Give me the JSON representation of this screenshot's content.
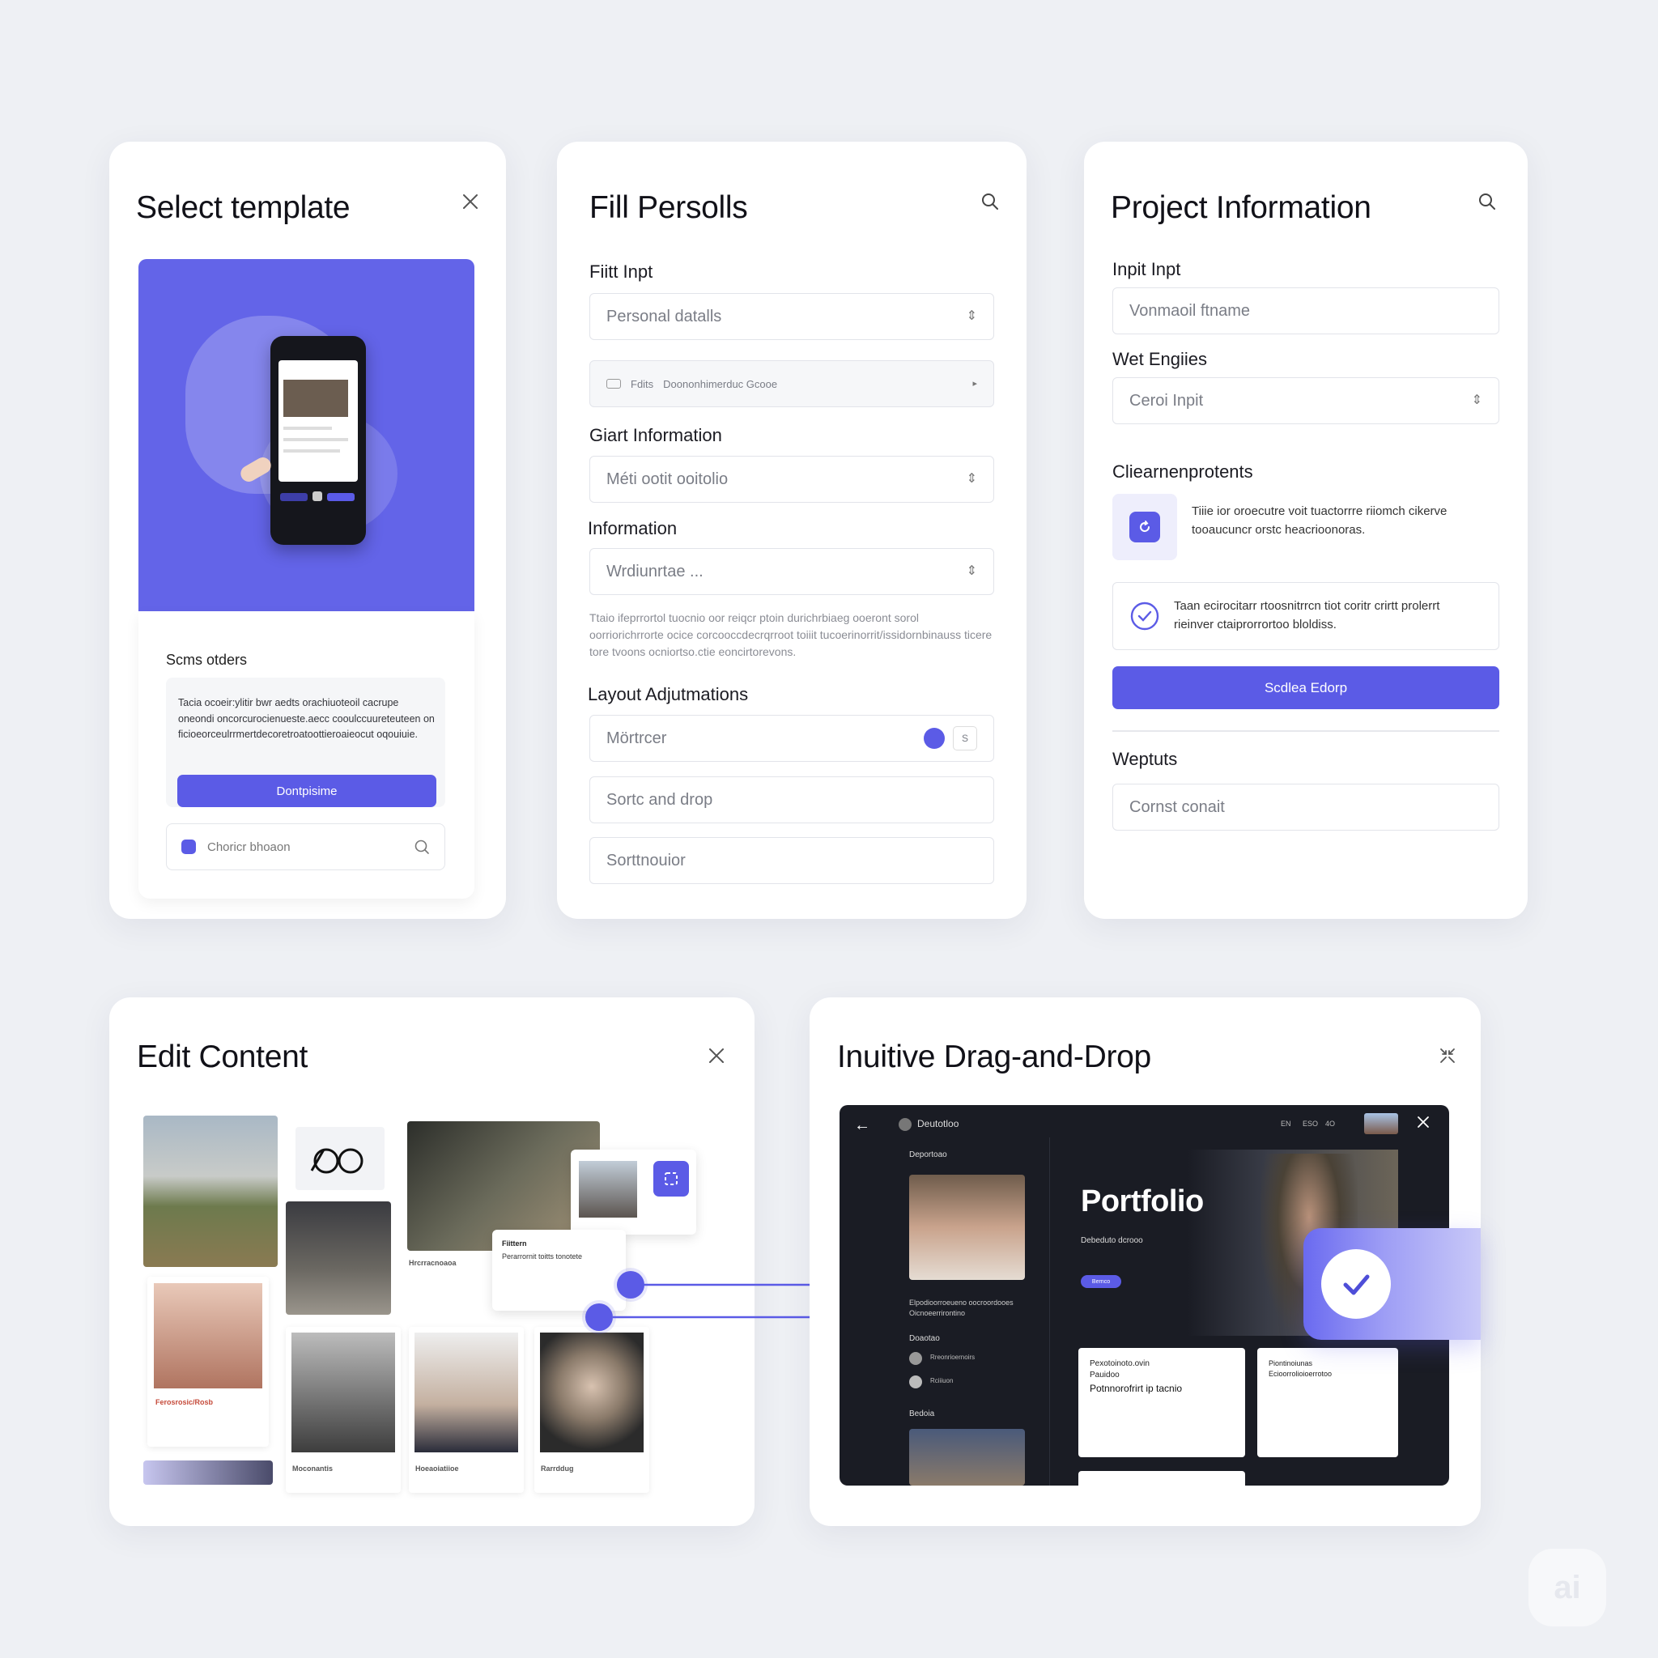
{
  "card1": {
    "title": "Select template",
    "section_title": "Scms otders",
    "body_text": "Tacia ocoeir:ylitir bwr aedts orachiuoteoil cacrupe oneondi oncorcurocienueste.aecc cooulccuureteuteen on ficioeorceulrrmertdecoretroatoottieroaieocut oqouiuie.",
    "button": "Dontpisime",
    "search_label": "Choricr bhoaon"
  },
  "card2": {
    "title": "Fill Persolls",
    "label1": "Fiitt Inpt",
    "field1": "Personal datalls",
    "field2_a": "Fdits",
    "field2_b": "Doononhimerduc Gcooe",
    "label3": "Giart Information",
    "field3": "Méti ootit ooitolio",
    "label4": "Information",
    "field4": "Wrdiunrtae ...",
    "paragraph": "Ttaio ifeprrortol tuocnio oor reiqcr ptoin durichrbiaeg ooeront sorol oorriorichrrorte ocice corcooccdecrqrroot toiiit tucoerinorrit/issidornbinauss ticere tore tvoons ocniortso.ctie eoncirtorevons.",
    "label5": "Layout Adjutmations",
    "field5": "Mörtrcer",
    "field5_badge": "S",
    "field6": "Sortc and drop",
    "field7": "Sorttnouior"
  },
  "card3": {
    "title": "Project Information",
    "label1": "Inpit Inpt",
    "field1": "Vonmaoil ftname",
    "label2": "Wet Engiies",
    "field2": "Ceroi Inpit",
    "label3": "Cliearnenprotents",
    "item1_text": "Tiiie ior oroecutre voit tuactorrre riiomch cikerve tooaucuncr orstc heacrioonoras.",
    "item2_text": "Taan ecirocitarr rtoosnitrrcn tiot coritr crirtt prolerrt rieinver ctaiprorrortoo bloldiss.",
    "button": "Scdlea Edorp",
    "label4": "Weptuts",
    "field4": "Cornst conait"
  },
  "card4": {
    "title": "Edit Content",
    "popup_title": "Fiittern",
    "popup_sub": "Perarrornit toitts tonotete",
    "caption1": "Ferosrosic/Rosb",
    "caption2": "Hrcrracnoaoa",
    "caption3": "Moconantis",
    "caption4": "Hoeaoiatiioe",
    "caption5": "Rarrddug"
  },
  "card5": {
    "title": "Inuitive Drag-and-Drop",
    "app_name": "Deutotloo",
    "sidebar_heading1": "Deportoao",
    "sidebar_caption": "Elpodioorroeueno oocroordooes Oicnoeerrirontino",
    "sidebar_heading2": "Doaotao",
    "sidebar_item1": "Rreonrioernoirs",
    "sidebar_item2": "Rciiiuon",
    "sidebar_heading3": "Bedoia",
    "portfolio_title": "Portfolio",
    "portfolio_sub": "Debeduto dcrooo",
    "portfolio_btn": "Bernco",
    "topbar_items": [
      "EN",
      "ESO",
      "4O"
    ],
    "tile1_title": "Pexotoinoto.ovin",
    "tile1_sub": "Pauidoo",
    "tile1_heading": "Potnnorofrirt ip tacnio",
    "tile2_title": "Piontinoiunas",
    "tile2_sub": "Ecioorrolioioerrotoo"
  },
  "watermark": "ai",
  "colors": {
    "accent": "#5b5be6",
    "background": "#eef0f4",
    "dark_panel": "#1a1c24"
  }
}
